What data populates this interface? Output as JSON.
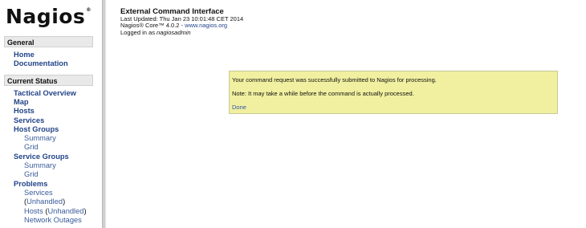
{
  "logo": {
    "text": "Nagios",
    "reg": "®"
  },
  "sidebar": {
    "general": {
      "title": "General",
      "items": [
        {
          "label": "Home"
        },
        {
          "label": "Documentation"
        }
      ]
    },
    "current_status": {
      "title": "Current Status",
      "items": {
        "tactical_overview": "Tactical Overview",
        "map": "Map",
        "hosts": "Hosts",
        "services": "Services",
        "host_groups": "Host Groups",
        "host_groups_summary": "Summary",
        "host_groups_grid": "Grid",
        "service_groups": "Service Groups",
        "service_groups_summary": "Summary",
        "service_groups_grid": "Grid",
        "problems": "Problems",
        "problems_services": "Services",
        "paren_open": "(",
        "unhandled": "Unhandled",
        "paren_close": ")",
        "problems_hosts": "Hosts",
        "hosts_unhandled": "Unhandled",
        "network_outages": "Network Outages"
      }
    }
  },
  "header": {
    "title": "External Command Interface",
    "last_updated": "Last Updated: Thu Jan 23 10:01:48 CET 2014",
    "version_prefix": "Nagios® Core™ 4.0.2 - ",
    "version_link": "www.nagios.org",
    "logged_in_prefix": "Logged in as ",
    "user": "nagiosadmin"
  },
  "message": {
    "line1": "Your command request was successfully submitted to Nagios for processing.",
    "line2": "Note: It may take a while before the command is actually processed.",
    "done": "Done"
  },
  "colors": {
    "message_bg": "#f0f0a0",
    "link": "#224488"
  }
}
